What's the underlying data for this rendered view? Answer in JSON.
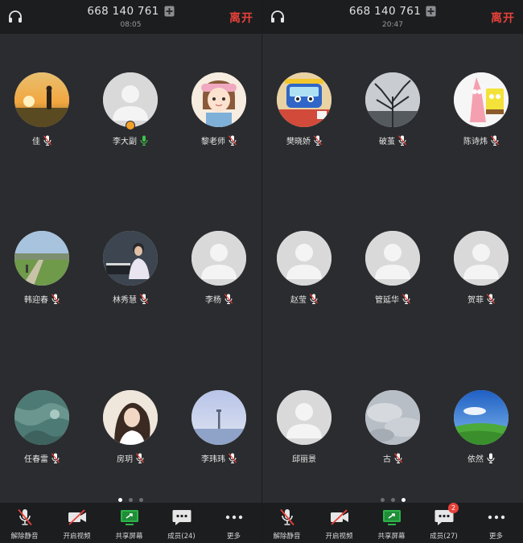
{
  "screens": [
    {
      "header": {
        "meeting_id": "668 140 761",
        "time": "08:05",
        "leave": "离开"
      },
      "participants": [
        {
          "name": "佳",
          "avatar": "sunset-photo",
          "mic": "muted"
        },
        {
          "name": "李大副",
          "avatar": "default",
          "mic": "speaking",
          "host": true
        },
        {
          "name": "黎老师",
          "avatar": "cartoon-girl",
          "mic": "muted"
        },
        {
          "name": "韩迎春",
          "avatar": "landscape-photo",
          "mic": "muted"
        },
        {
          "name": "林秀慧",
          "avatar": "piano-photo",
          "mic": "muted"
        },
        {
          "name": "李杨",
          "avatar": "default",
          "mic": "muted"
        },
        {
          "name": "任春雷",
          "avatar": "teal-photo",
          "mic": "muted"
        },
        {
          "name": "房玥",
          "avatar": "portrait-photo",
          "mic": "muted"
        },
        {
          "name": "李玮玮",
          "avatar": "sky-photo",
          "mic": "muted"
        }
      ],
      "page_dots": [
        true,
        false,
        false
      ],
      "toolbar": [
        {
          "id": "unmute",
          "label": "解除静音",
          "icon": "mic-off-icon"
        },
        {
          "id": "video",
          "label": "开启视频",
          "icon": "video-off-icon"
        },
        {
          "id": "share",
          "label": "共享屏幕",
          "icon": "share-screen-icon"
        },
        {
          "id": "members",
          "label": "成员(24)",
          "icon": "members-icon"
        },
        {
          "id": "more",
          "label": "更多",
          "icon": "more-icon"
        }
      ]
    },
    {
      "header": {
        "meeting_id": "668 140 761",
        "time": "20:47",
        "leave": "离开"
      },
      "participants": [
        {
          "name": "樊晓娇",
          "avatar": "bus-toy-photo",
          "mic": "muted"
        },
        {
          "name": "破茧",
          "avatar": "tree-photo",
          "mic": "muted"
        },
        {
          "name": "陈诗炜",
          "avatar": "cartoon-patrick",
          "mic": "muted"
        },
        {
          "name": "赵莹",
          "avatar": "default",
          "mic": "muted"
        },
        {
          "name": "管延华",
          "avatar": "default",
          "mic": "muted"
        },
        {
          "name": "贺菲",
          "avatar": "default",
          "mic": "muted"
        },
        {
          "name": "邱丽景",
          "avatar": "default",
          "mic": "none"
        },
        {
          "name": "古",
          "avatar": "cloudy-photo",
          "mic": "muted"
        },
        {
          "name": "依然",
          "avatar": "meadow-photo",
          "mic": "on"
        }
      ],
      "page_dots": [
        false,
        false,
        true
      ],
      "toolbar": [
        {
          "id": "unmute",
          "label": "解除静音",
          "icon": "mic-off-icon"
        },
        {
          "id": "video",
          "label": "开启视频",
          "icon": "video-off-icon"
        },
        {
          "id": "share",
          "label": "共享屏幕",
          "icon": "share-screen-icon"
        },
        {
          "id": "members",
          "label": "成员(27)",
          "icon": "members-icon",
          "badge": "2"
        },
        {
          "id": "more",
          "label": "更多",
          "icon": "more-icon"
        }
      ]
    }
  ],
  "colors": {
    "accent_red": "#e8413a",
    "speaking_green": "#3fc24a",
    "host_orange": "#f2a12a",
    "background": "#2b2c2f",
    "bar": "#1c1d1f"
  }
}
